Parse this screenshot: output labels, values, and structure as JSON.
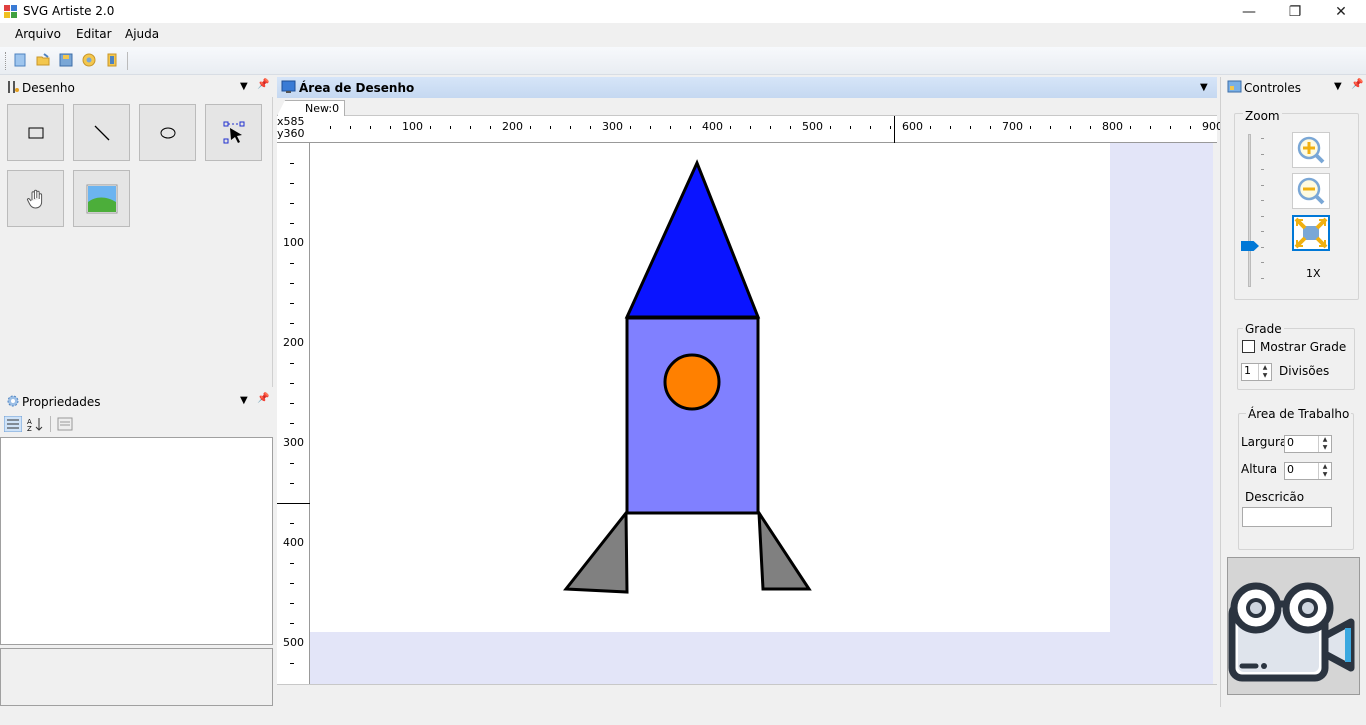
{
  "window": {
    "title": "SVG Artiste 2.0",
    "minimize": "—",
    "maximize": "❐",
    "close": "✕"
  },
  "menu": {
    "file": "Arquivo",
    "edit": "Editar",
    "help": "Ajuda"
  },
  "panels": {
    "drawing": {
      "title": "Desenho"
    },
    "properties": {
      "title": "Propriedades"
    },
    "controls": {
      "title": "Controles"
    }
  },
  "document": {
    "title": "Área de Desenho",
    "tab": "New:0",
    "coord_x": "x585",
    "coord_y": "y360"
  },
  "rulers": {
    "horizontal": [
      "100",
      "200",
      "300",
      "400",
      "500",
      "600",
      "700",
      "800",
      "900"
    ],
    "vertical": [
      "100",
      "200",
      "300",
      "400",
      "500"
    ]
  },
  "zoom": {
    "label": "Zoom",
    "level": "1X",
    "slider_position": 0.15
  },
  "grid": {
    "title": "Grade",
    "show_label": "Mostrar Grade",
    "show_checked": false,
    "divisions_value": "1",
    "divisions_label": "Divisões"
  },
  "workarea": {
    "title": "Área de Trabalho",
    "width_label": "Largura",
    "width_value": "0",
    "height_label": "Altura",
    "height_value": "0",
    "description_label": "Descricão",
    "description_value": ""
  },
  "drawing": {
    "nose_fill": "#0a14ff",
    "body_fill": "#8080ff",
    "window_fill": "#ff8000",
    "fins_fill": "#808080"
  },
  "icons": {
    "tool_rect": "rectangle-icon",
    "tool_line": "line-icon",
    "tool_ellipse": "ellipse-icon",
    "tool_select": "select-pointer-icon",
    "tool_pan": "hand-icon",
    "tool_image": "image-icon",
    "zoom_in": "zoom-in-icon",
    "zoom_out": "zoom-out-icon",
    "zoom_fit": "zoom-fit-icon",
    "camera": "video-camera-icon"
  }
}
